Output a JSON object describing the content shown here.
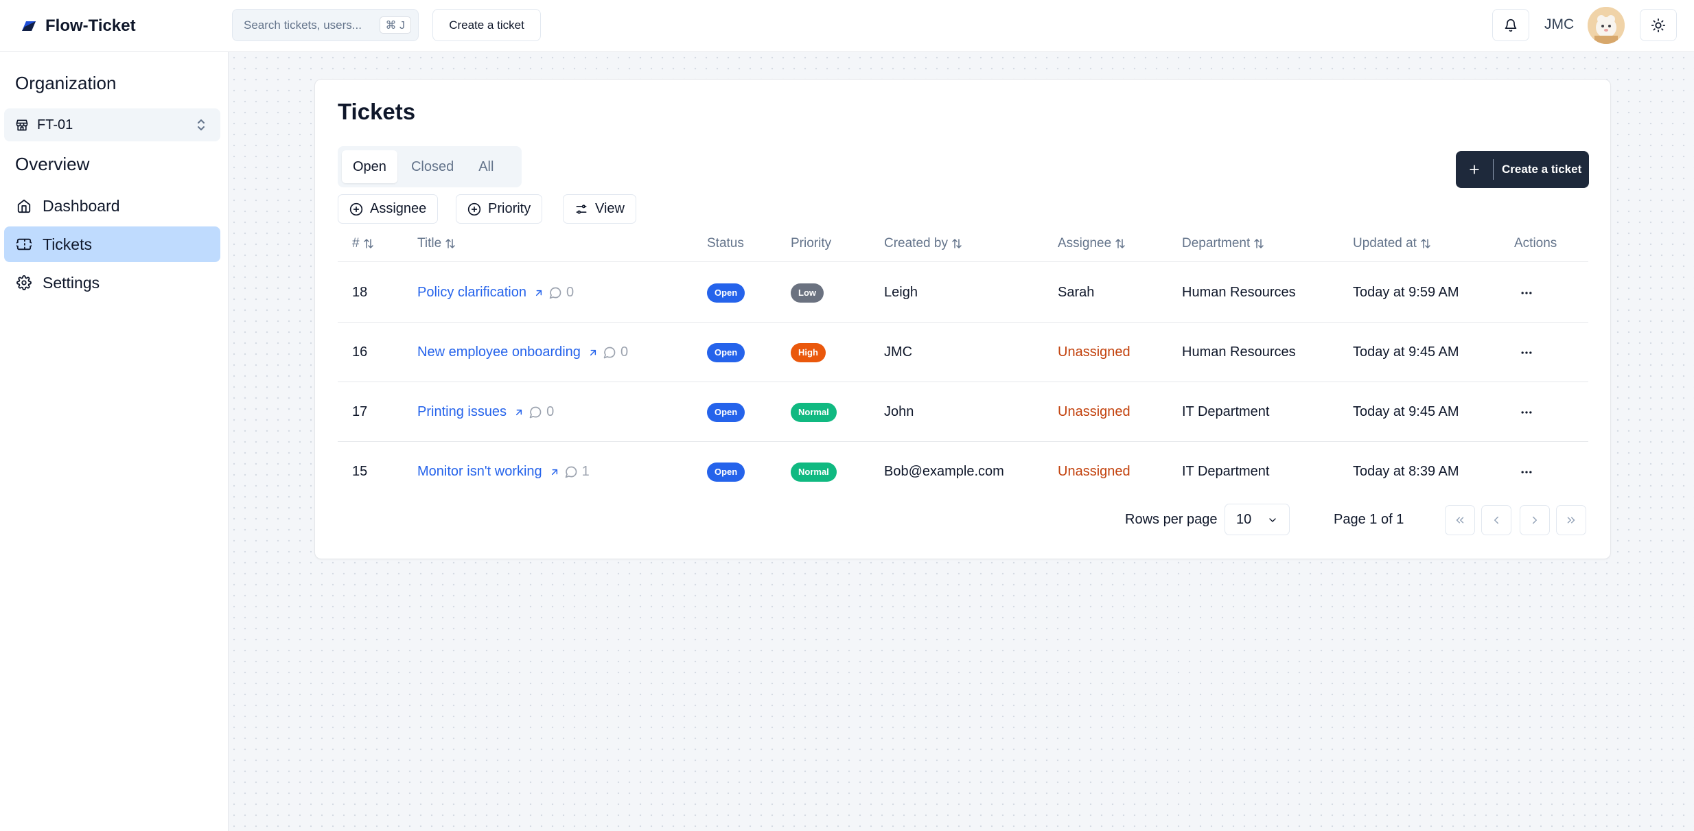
{
  "app": {
    "name": "Flow-Ticket",
    "brand_color": "#1d4ed8"
  },
  "header": {
    "search_placeholder": "Search tickets, users...",
    "search_shortcut": "⌘ J",
    "create_label": "Create a ticket",
    "user_name": "JMC",
    "icons": {
      "notifications": "bell-icon",
      "theme": "sun-icon"
    }
  },
  "sidebar": {
    "organization_heading": "Organization",
    "org_selected": "FT-01",
    "overview_heading": "Overview",
    "items": [
      {
        "label": "Dashboard",
        "icon": "home-icon",
        "active": false
      },
      {
        "label": "Tickets",
        "icon": "ticket-icon",
        "active": true
      },
      {
        "label": "Settings",
        "icon": "gear-icon",
        "active": false
      }
    ],
    "active_color": "#bfdbfe"
  },
  "main": {
    "title": "Tickets",
    "tabs": [
      {
        "label": "Open",
        "active": true
      },
      {
        "label": "Closed",
        "active": false
      },
      {
        "label": "All",
        "active": false
      }
    ],
    "create_button_label": "Create a ticket",
    "filters": [
      {
        "label": "Assignee",
        "icon": "plus-circle-icon"
      },
      {
        "label": "Priority",
        "icon": "plus-circle-icon"
      },
      {
        "label": "View",
        "icon": "sliders-icon"
      }
    ]
  },
  "table": {
    "columns": [
      "#",
      "Title",
      "Status",
      "Priority",
      "Created by",
      "Assignee",
      "Department",
      "Updated at",
      "Actions"
    ],
    "rows": [
      {
        "id": "18",
        "title": "Policy clarification",
        "comments": "0",
        "status": "Open",
        "priority": "Low",
        "created_by": "Leigh",
        "assignee": "Sarah",
        "department": "Human Resources",
        "updated": "Today at 9:59 AM"
      },
      {
        "id": "16",
        "title": "New employee onboarding",
        "comments": "0",
        "status": "Open",
        "priority": "High",
        "created_by": "JMC",
        "assignee": "Unassigned",
        "department": "Human Resources",
        "updated": "Today at 9:45 AM"
      },
      {
        "id": "17",
        "title": "Printing issues",
        "comments": "0",
        "status": "Open",
        "priority": "Normal",
        "created_by": "John",
        "assignee": "Unassigned",
        "department": "IT Department",
        "updated": "Today at 9:45 AM"
      },
      {
        "id": "15",
        "title": "Monitor isn't working",
        "comments": "1",
        "status": "Open",
        "priority": "Normal",
        "created_by": "Bob@example.com",
        "assignee": "Unassigned",
        "department": "IT Department",
        "updated": "Today at 8:39 AM"
      }
    ],
    "colors": {
      "status_open": "#2563eb",
      "priority_low": "#6b7280",
      "priority_high": "#ea580c",
      "priority_normal": "#10b981",
      "unassigned": "#c2410c",
      "link": "#2563eb"
    }
  },
  "pagination": {
    "rows_per_page_label": "Rows per page",
    "rows_per_page_value": "10",
    "page_prefix": "Page ",
    "current_page": "1",
    "page_of": " of ",
    "total_pages": "1"
  }
}
